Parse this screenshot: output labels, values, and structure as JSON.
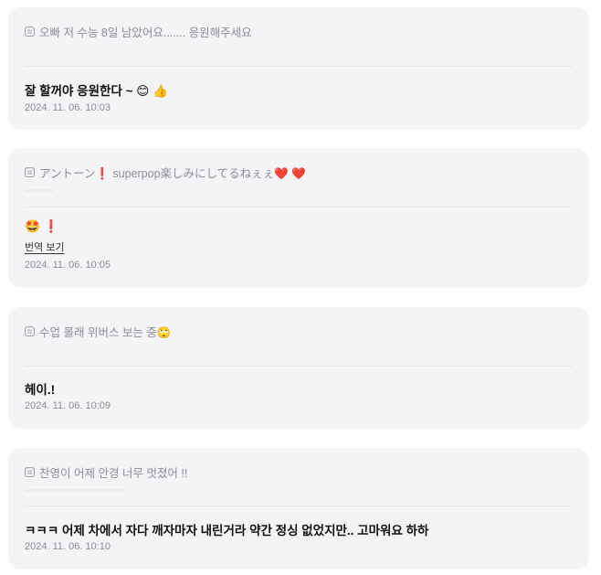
{
  "comments": [
    {
      "quote": "오빠 저 수능 8일 남았어요....... 응원해주세요",
      "reply": "잘 할꺼야 응원한다 ~ 😊 👍",
      "timestamp": "2024. 11. 06. 10:03"
    },
    {
      "quote": "アントーン❗ superpop楽しみにしてるねぇぇ❤️ ❤️",
      "reply": "🤩 ❗",
      "translate_label": "번역 보기",
      "timestamp": "2024. 11. 06. 10:05"
    },
    {
      "quote": "수업 몰래 위버스 보는 중🙄",
      "reply": "헤이.!",
      "timestamp": "2024. 11. 06. 10:09"
    },
    {
      "quote": "찬영이 어제 안경 너무 멋졌어 !!",
      "reply": "ㅋㅋㅋ 어제 차에서 자다 깨자마자 내린거라 약간 정싱 없었지만.. 고마워요 하하",
      "timestamp": "2024. 11. 06. 10:10"
    }
  ],
  "icons": {
    "quote": "document-icon"
  },
  "colors": {
    "card_background": "#f4f4f6",
    "muted_text": "#8c8c96",
    "primary_text": "#111111"
  }
}
